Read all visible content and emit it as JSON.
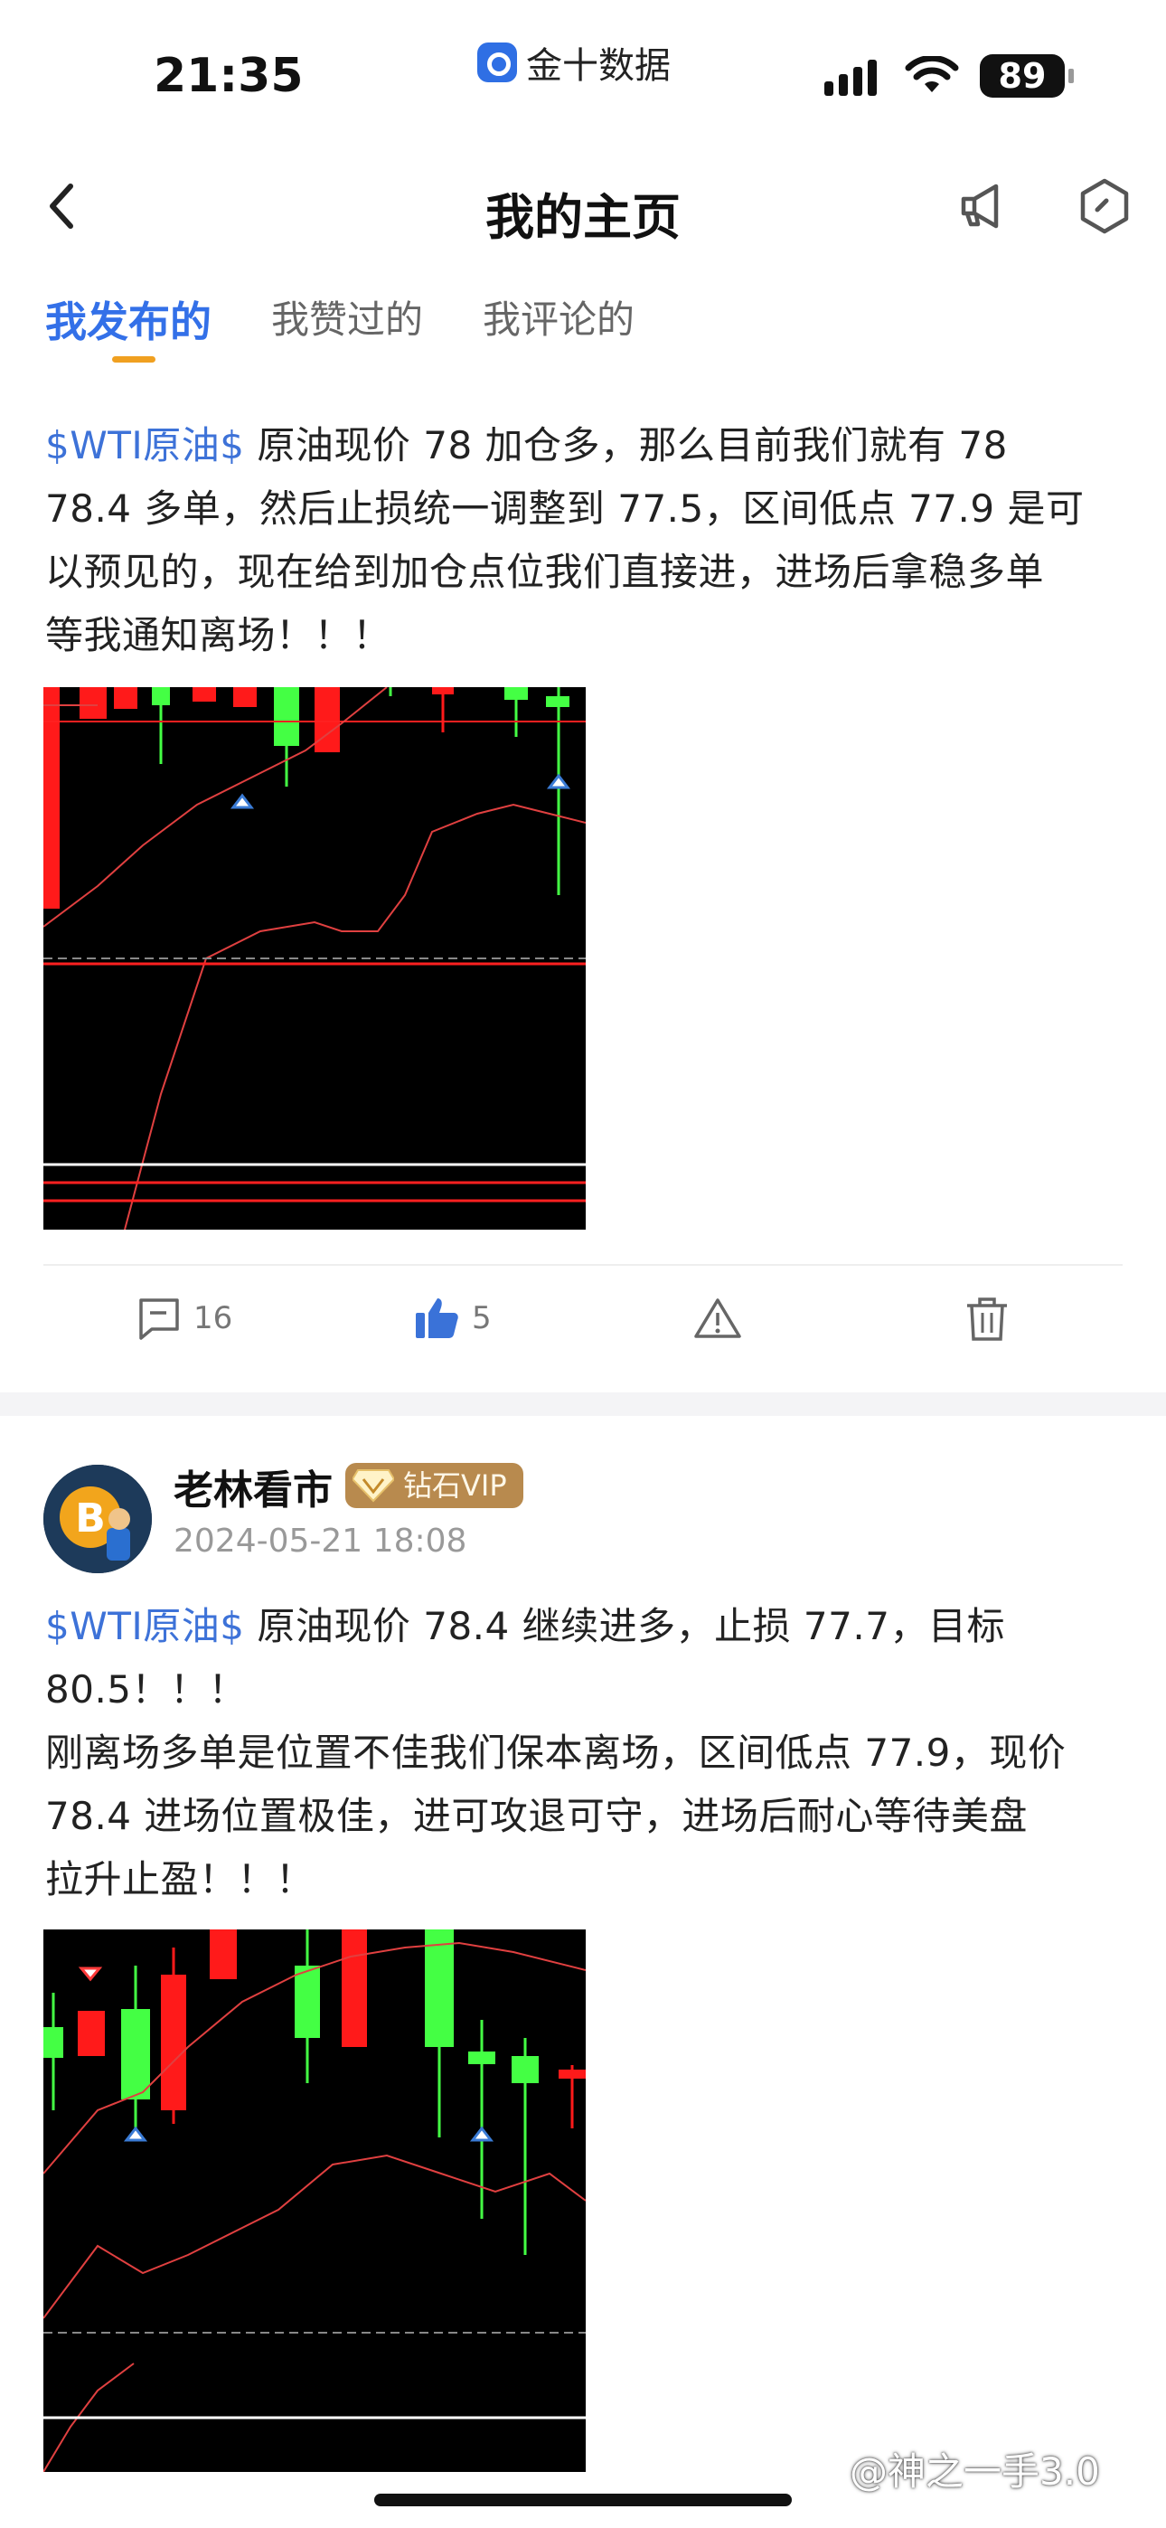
{
  "status_bar": {
    "time": "21:35",
    "app_name": "金十数据",
    "battery": "89"
  },
  "nav": {
    "title": "我的主页"
  },
  "tabs": [
    {
      "label": "我发布的",
      "active": true
    },
    {
      "label": "我赞过的",
      "active": false
    },
    {
      "label": "我评论的",
      "active": false
    }
  ],
  "post1": {
    "topic": "$WTI原油$",
    "lines": [
      " 原油现价 78 加仓多，那么目前我们就有 78",
      "78.4 多单，然后止损统一调整到 77.5，区间低点 77.9 是可",
      "以预见的，现在给到加仓点位我们直接进，进场后拿稳多单",
      "等我通知离场！！！"
    ],
    "comments": "16",
    "likes": "5"
  },
  "post2": {
    "author": "老林看市",
    "badge": "钻石VIP",
    "date": "2024-05-21 18:08",
    "topic": "$WTI原油$",
    "lines": [
      " 原油现价 78.4 继续进多，止损 77.7，目标",
      "80.5！！！",
      "刚离场多单是位置不佳我们保本离场，区间低点 77.9，现价",
      "78.4 进场位置极佳，进可攻退可守，进场后耐心等待美盘",
      "拉升止盈！！！"
    ]
  },
  "watermark": "@神之一手3.0",
  "colors": {
    "accent": "#3370e8",
    "topic": "#3d72d8",
    "tab_underline": "#f0a020",
    "vip": "#b88a4e"
  }
}
